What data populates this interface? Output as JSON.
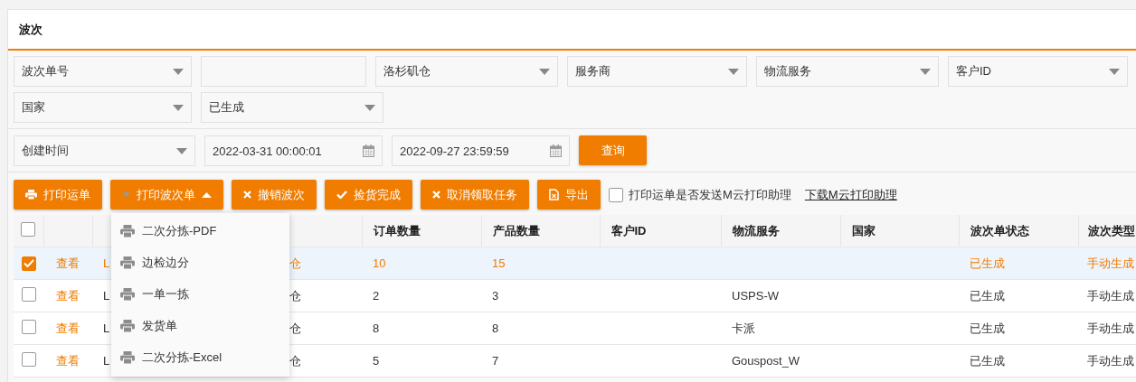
{
  "title": "波次",
  "filter_rows": [
    [
      {
        "kind": "select",
        "value": "波次单号"
      },
      {
        "kind": "input"
      },
      {
        "kind": "select",
        "value": "洛杉矶仓"
      },
      {
        "kind": "select",
        "value": "服务商"
      },
      {
        "kind": "select",
        "value": "物流服务"
      },
      {
        "kind": "select",
        "value": "客户ID"
      }
    ],
    [
      {
        "kind": "select",
        "value": "国家"
      },
      {
        "kind": "select",
        "value": "已生成"
      }
    ],
    [
      {
        "kind": "select",
        "value": "创建时间"
      },
      {
        "kind": "date",
        "value": "2022-03-31 00:00:01"
      },
      {
        "kind": "date",
        "value": "2022-09-27 23:59:59"
      },
      {
        "kind": "button",
        "value": "查询"
      }
    ]
  ],
  "toolbar": [
    {
      "label": "打印运单",
      "kind": "print"
    },
    {
      "label": "打印波次单",
      "kind": "menu",
      "expanded": true
    },
    {
      "label": "撤销波次",
      "kind": "cancel"
    },
    {
      "label": "捡货完成",
      "kind": "confirm"
    },
    {
      "label": "取消领取任务",
      "kind": "cancel"
    },
    {
      "label": "导出",
      "kind": "export"
    }
  ],
  "send_option": {
    "label": "打印运单是否发送M云打印助理",
    "checked": false
  },
  "download_link": "下载M云打印助理",
  "print_menu": [
    "二次分拣-PDF",
    "边检边分",
    "一单一拣",
    "发货单",
    "二次分拣-Excel"
  ],
  "table": {
    "header_checked": false,
    "columns": [
      "",
      "",
      "",
      "订单数量",
      "产品数量",
      "客户ID",
      "物流服务",
      "国家",
      "波次单状态",
      "波次类型"
    ],
    "rows": [
      {
        "selected": true,
        "cells": [
          "查看",
          "L",
          "仓",
          "10",
          "15",
          "",
          "",
          "",
          "已生成",
          "手动生成"
        ]
      },
      {
        "selected": false,
        "cells": [
          "查看",
          "L",
          "仓",
          "2",
          "3",
          "",
          "USPS-W",
          "",
          "已生成",
          "手动生成"
        ]
      },
      {
        "selected": false,
        "cells": [
          "查看",
          "L",
          "仓",
          "8",
          "8",
          "",
          "卡派",
          "",
          "已生成",
          "手动生成"
        ]
      },
      {
        "selected": false,
        "cells": [
          "查看",
          "L",
          "仓",
          "5",
          "7",
          "",
          "Gouspost_W",
          "",
          "已生成",
          "手动生成"
        ]
      }
    ]
  }
}
